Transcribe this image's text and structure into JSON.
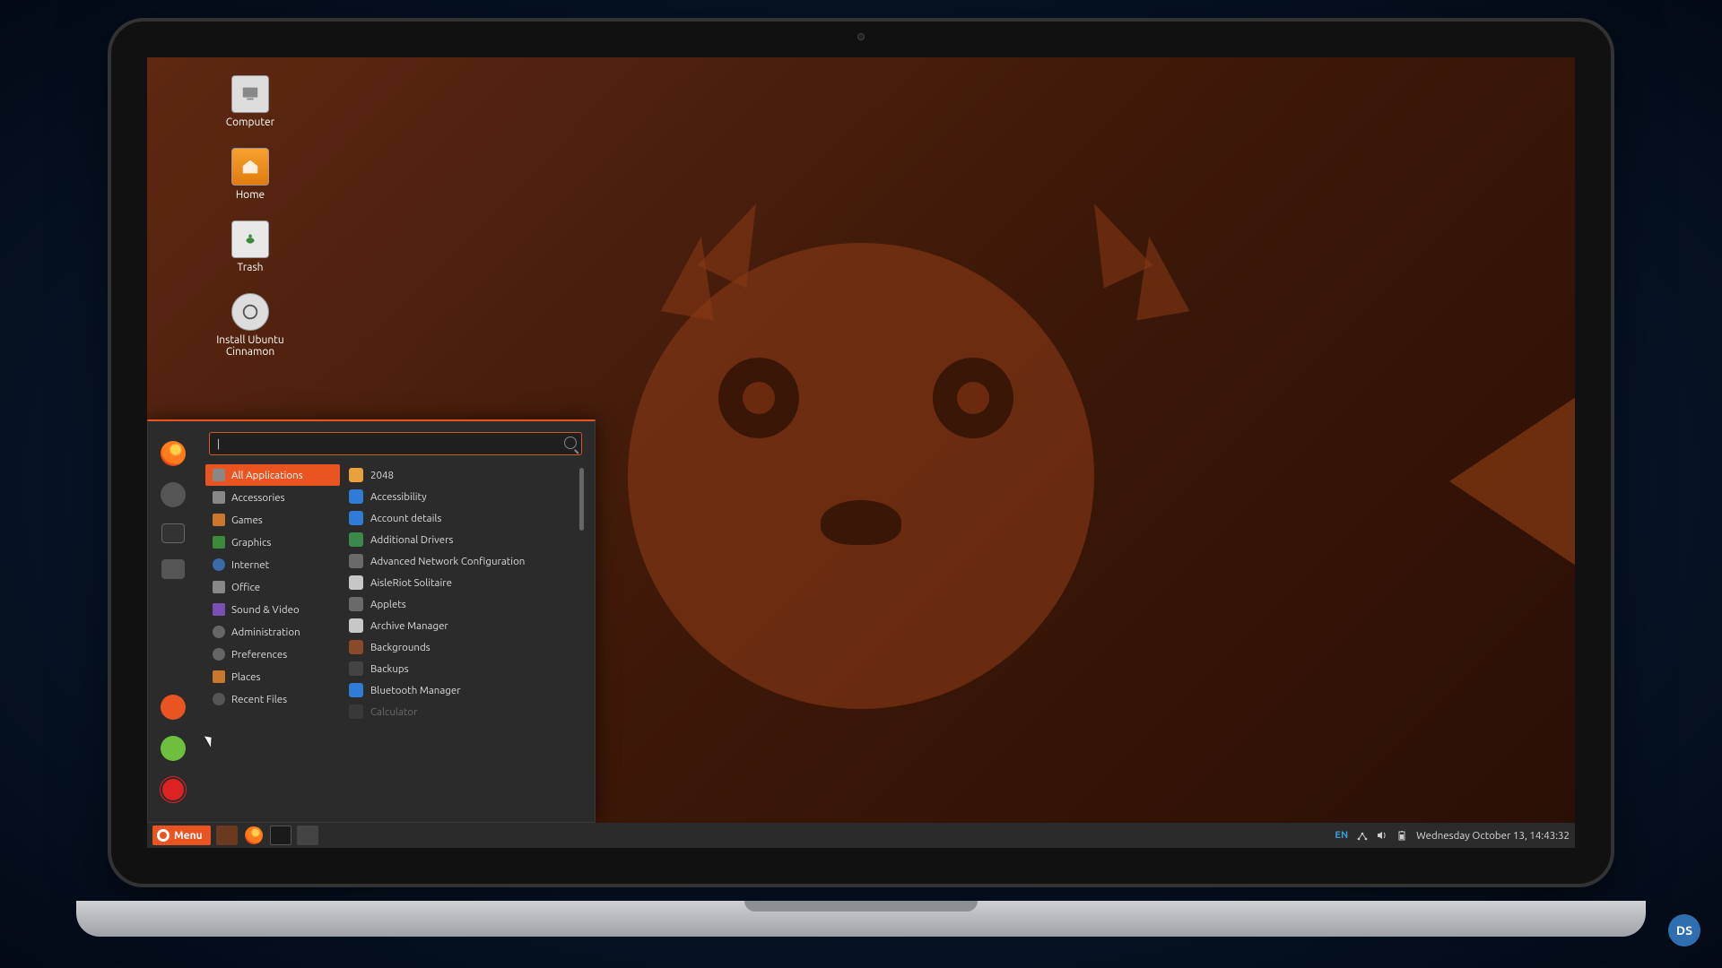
{
  "desktop_icons": [
    {
      "name": "computer",
      "label": "Computer"
    },
    {
      "name": "home",
      "label": "Home"
    },
    {
      "name": "trash",
      "label": "Trash"
    },
    {
      "name": "install",
      "label": "Install Ubuntu Cinnamon"
    }
  ],
  "menu": {
    "search_placeholder": "",
    "categories": [
      {
        "label": "All Applications",
        "active": true,
        "icon": "apps"
      },
      {
        "label": "Accessories",
        "icon": "acc"
      },
      {
        "label": "Games",
        "icon": "folder"
      },
      {
        "label": "Graphics",
        "icon": "green"
      },
      {
        "label": "Internet",
        "icon": "globe"
      },
      {
        "label": "Office",
        "icon": "office"
      },
      {
        "label": "Sound & Video",
        "icon": "purple"
      },
      {
        "label": "Administration",
        "icon": "gear"
      },
      {
        "label": "Preferences",
        "icon": "gear"
      },
      {
        "label": "Places",
        "icon": "folder"
      },
      {
        "label": "Recent Files",
        "icon": "time"
      }
    ],
    "apps": [
      {
        "label": "2048",
        "color": "#e9a23b"
      },
      {
        "label": "Accessibility",
        "color": "#2f7bd6"
      },
      {
        "label": "Account details",
        "color": "#2f7bd6"
      },
      {
        "label": "Additional Drivers",
        "color": "#3b8a4a"
      },
      {
        "label": "Advanced Network Configuration",
        "color": "#6a6a6a"
      },
      {
        "label": "AisleRiot Solitaire",
        "color": "#c7c7c7"
      },
      {
        "label": "Applets",
        "color": "#6a6a6a"
      },
      {
        "label": "Archive Manager",
        "color": "#c7c7c7"
      },
      {
        "label": "Backgrounds",
        "color": "#8a4a2a"
      },
      {
        "label": "Backups",
        "color": "#444"
      },
      {
        "label": "Bluetooth Manager",
        "color": "#2f7bd6"
      },
      {
        "label": "Calculator",
        "color": "#555",
        "fade": true
      }
    ],
    "favorites": [
      "firefox",
      "settings",
      "terminal",
      "files"
    ],
    "session": [
      "lock",
      "logout",
      "power"
    ]
  },
  "taskbar": {
    "menu_label": "Menu",
    "launchers": [
      "show-desktop",
      "firefox",
      "terminal",
      "files"
    ],
    "tray": {
      "lang": "EN"
    },
    "clock": "Wednesday October 13, 14:43:32"
  },
  "badge": "DS"
}
